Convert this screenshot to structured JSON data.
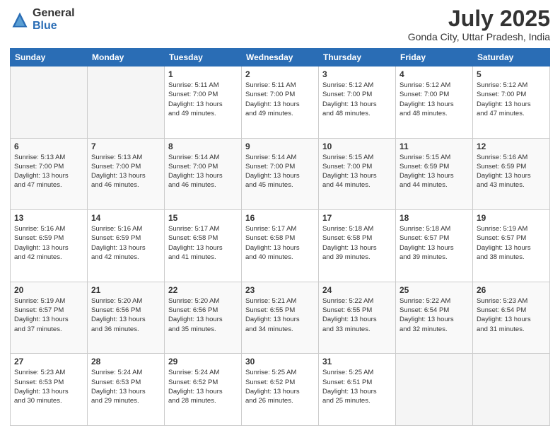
{
  "header": {
    "logo_general": "General",
    "logo_blue": "Blue",
    "month_year": "July 2025",
    "location": "Gonda City, Uttar Pradesh, India"
  },
  "days_of_week": [
    "Sunday",
    "Monday",
    "Tuesday",
    "Wednesday",
    "Thursday",
    "Friday",
    "Saturday"
  ],
  "weeks": [
    [
      {
        "num": "",
        "info": ""
      },
      {
        "num": "",
        "info": ""
      },
      {
        "num": "1",
        "info": "Sunrise: 5:11 AM\nSunset: 7:00 PM\nDaylight: 13 hours\nand 49 minutes."
      },
      {
        "num": "2",
        "info": "Sunrise: 5:11 AM\nSunset: 7:00 PM\nDaylight: 13 hours\nand 49 minutes."
      },
      {
        "num": "3",
        "info": "Sunrise: 5:12 AM\nSunset: 7:00 PM\nDaylight: 13 hours\nand 48 minutes."
      },
      {
        "num": "4",
        "info": "Sunrise: 5:12 AM\nSunset: 7:00 PM\nDaylight: 13 hours\nand 48 minutes."
      },
      {
        "num": "5",
        "info": "Sunrise: 5:12 AM\nSunset: 7:00 PM\nDaylight: 13 hours\nand 47 minutes."
      }
    ],
    [
      {
        "num": "6",
        "info": "Sunrise: 5:13 AM\nSunset: 7:00 PM\nDaylight: 13 hours\nand 47 minutes."
      },
      {
        "num": "7",
        "info": "Sunrise: 5:13 AM\nSunset: 7:00 PM\nDaylight: 13 hours\nand 46 minutes."
      },
      {
        "num": "8",
        "info": "Sunrise: 5:14 AM\nSunset: 7:00 PM\nDaylight: 13 hours\nand 46 minutes."
      },
      {
        "num": "9",
        "info": "Sunrise: 5:14 AM\nSunset: 7:00 PM\nDaylight: 13 hours\nand 45 minutes."
      },
      {
        "num": "10",
        "info": "Sunrise: 5:15 AM\nSunset: 7:00 PM\nDaylight: 13 hours\nand 44 minutes."
      },
      {
        "num": "11",
        "info": "Sunrise: 5:15 AM\nSunset: 6:59 PM\nDaylight: 13 hours\nand 44 minutes."
      },
      {
        "num": "12",
        "info": "Sunrise: 5:16 AM\nSunset: 6:59 PM\nDaylight: 13 hours\nand 43 minutes."
      }
    ],
    [
      {
        "num": "13",
        "info": "Sunrise: 5:16 AM\nSunset: 6:59 PM\nDaylight: 13 hours\nand 42 minutes."
      },
      {
        "num": "14",
        "info": "Sunrise: 5:16 AM\nSunset: 6:59 PM\nDaylight: 13 hours\nand 42 minutes."
      },
      {
        "num": "15",
        "info": "Sunrise: 5:17 AM\nSunset: 6:58 PM\nDaylight: 13 hours\nand 41 minutes."
      },
      {
        "num": "16",
        "info": "Sunrise: 5:17 AM\nSunset: 6:58 PM\nDaylight: 13 hours\nand 40 minutes."
      },
      {
        "num": "17",
        "info": "Sunrise: 5:18 AM\nSunset: 6:58 PM\nDaylight: 13 hours\nand 39 minutes."
      },
      {
        "num": "18",
        "info": "Sunrise: 5:18 AM\nSunset: 6:57 PM\nDaylight: 13 hours\nand 39 minutes."
      },
      {
        "num": "19",
        "info": "Sunrise: 5:19 AM\nSunset: 6:57 PM\nDaylight: 13 hours\nand 38 minutes."
      }
    ],
    [
      {
        "num": "20",
        "info": "Sunrise: 5:19 AM\nSunset: 6:57 PM\nDaylight: 13 hours\nand 37 minutes."
      },
      {
        "num": "21",
        "info": "Sunrise: 5:20 AM\nSunset: 6:56 PM\nDaylight: 13 hours\nand 36 minutes."
      },
      {
        "num": "22",
        "info": "Sunrise: 5:20 AM\nSunset: 6:56 PM\nDaylight: 13 hours\nand 35 minutes."
      },
      {
        "num": "23",
        "info": "Sunrise: 5:21 AM\nSunset: 6:55 PM\nDaylight: 13 hours\nand 34 minutes."
      },
      {
        "num": "24",
        "info": "Sunrise: 5:22 AM\nSunset: 6:55 PM\nDaylight: 13 hours\nand 33 minutes."
      },
      {
        "num": "25",
        "info": "Sunrise: 5:22 AM\nSunset: 6:54 PM\nDaylight: 13 hours\nand 32 minutes."
      },
      {
        "num": "26",
        "info": "Sunrise: 5:23 AM\nSunset: 6:54 PM\nDaylight: 13 hours\nand 31 minutes."
      }
    ],
    [
      {
        "num": "27",
        "info": "Sunrise: 5:23 AM\nSunset: 6:53 PM\nDaylight: 13 hours\nand 30 minutes."
      },
      {
        "num": "28",
        "info": "Sunrise: 5:24 AM\nSunset: 6:53 PM\nDaylight: 13 hours\nand 29 minutes."
      },
      {
        "num": "29",
        "info": "Sunrise: 5:24 AM\nSunset: 6:52 PM\nDaylight: 13 hours\nand 28 minutes."
      },
      {
        "num": "30",
        "info": "Sunrise: 5:25 AM\nSunset: 6:52 PM\nDaylight: 13 hours\nand 26 minutes."
      },
      {
        "num": "31",
        "info": "Sunrise: 5:25 AM\nSunset: 6:51 PM\nDaylight: 13 hours\nand 25 minutes."
      },
      {
        "num": "",
        "info": ""
      },
      {
        "num": "",
        "info": ""
      }
    ]
  ]
}
